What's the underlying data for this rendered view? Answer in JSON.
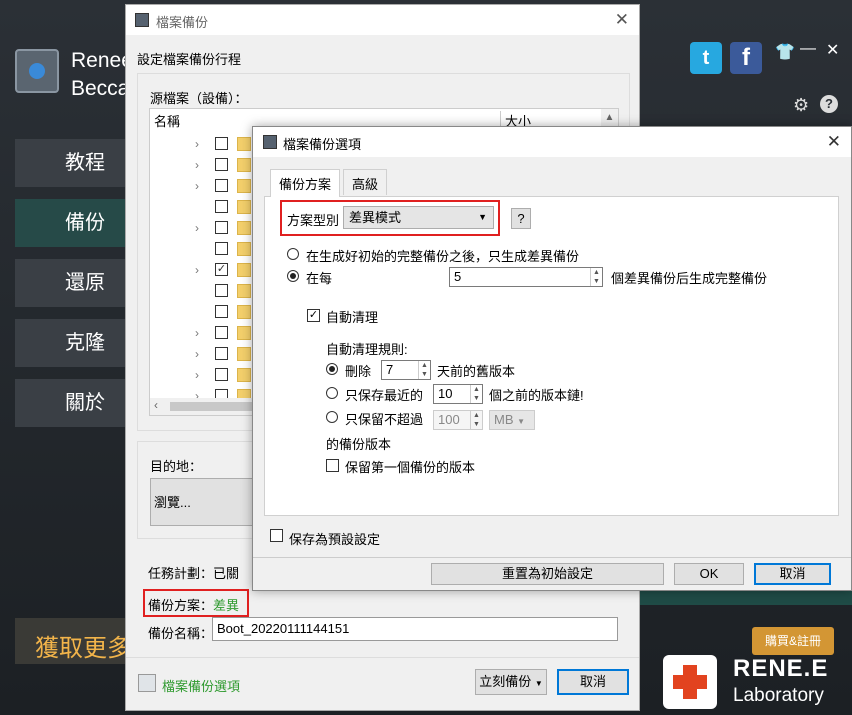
{
  "app": {
    "name_line1": "Renee",
    "name_line2": "Becca",
    "sidebar": [
      {
        "label": "教程",
        "active": false
      },
      {
        "label": "備份",
        "active": true
      },
      {
        "label": "還原",
        "active": false
      },
      {
        "label": "克隆",
        "active": false
      },
      {
        "label": "關於",
        "active": false
      }
    ],
    "promo": "獲取更多",
    "buy_label": "購買&註冊",
    "brand_name": "RENE.E",
    "brand_sub": "Laboratory",
    "twitter_glyph": "t",
    "facebook_glyph": "f",
    "icons": [
      "twitter-icon",
      "facebook-icon",
      "shirt-icon",
      "minimize-icon",
      "close-icon",
      "gear-icon",
      "help-icon"
    ]
  },
  "backup_dialog": {
    "title": "檔案備份",
    "heading": "設定檔案備份行程",
    "source_label": "源檔案（設備）：",
    "columns": {
      "name": "名稱",
      "size": "大小"
    },
    "tree_rows": [
      {
        "expand": true,
        "checked": false
      },
      {
        "expand": true,
        "checked": false
      },
      {
        "expand": true,
        "checked": false
      },
      {
        "expand": false,
        "checked": false
      },
      {
        "expand": true,
        "checked": false
      },
      {
        "expand": false,
        "checked": false
      },
      {
        "expand": true,
        "checked": true
      },
      {
        "expand": false,
        "checked": false
      },
      {
        "expand": false,
        "checked": false
      },
      {
        "expand": true,
        "checked": false
      },
      {
        "expand": true,
        "checked": false
      },
      {
        "expand": true,
        "checked": false
      },
      {
        "expand": true,
        "checked": false
      }
    ],
    "dest_label": "目的地：",
    "browse_label": "瀏覽...",
    "task_schedule": "任務計劃：已關",
    "scheme_label": "備份方案：",
    "scheme_value": "差異",
    "name_label": "備份名稱：",
    "name_value": "Boot_20220111144151",
    "options_link": "檔案備份選項",
    "backup_now": "立刻備份",
    "cancel": "取消"
  },
  "options_dialog": {
    "title": "檔案備份選項",
    "tabs": [
      "備份方案",
      "高級"
    ],
    "scheme_type_label": "方案型別",
    "scheme_type_value": "差異模式",
    "help_label": "?",
    "radio_after_full": "在生成好初始的完整備份之後，只生成差異備份",
    "radio_every": "在每",
    "every_value": "5",
    "every_suffix": "個差異備份后生成完整備份",
    "auto_clean_label": "自動清理",
    "auto_clean_checked": true,
    "rules_label": "自動清理規則:",
    "delete_label": "刪除",
    "delete_days": "7",
    "delete_suffix": "天前的舊版本",
    "keep_recent_label": "只保存最近的",
    "keep_recent_value": "10",
    "keep_recent_suffix": "個之前的版本鏈!",
    "keep_max_label": "只保留不超過",
    "keep_max_value": "100",
    "keep_max_unit": "MB",
    "versions_label": "的備份版本",
    "keep_first_label": "保留第一個備份的版本",
    "save_default_label": "保存為預設設定",
    "reset_label": "重置為初始設定",
    "ok_label": "OK",
    "cancel_label": "取消"
  }
}
